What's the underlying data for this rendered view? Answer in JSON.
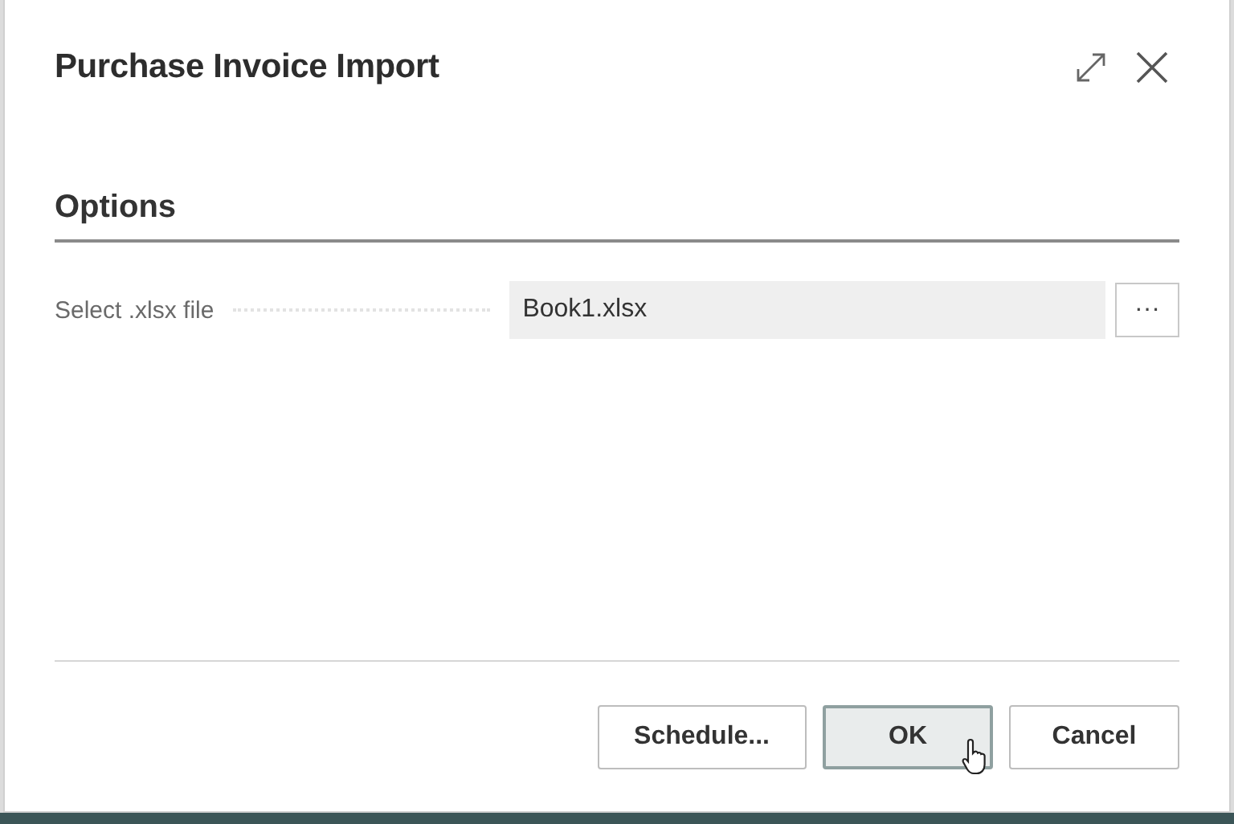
{
  "dialog": {
    "title": "Purchase Invoice Import"
  },
  "section": {
    "title": "Options"
  },
  "fields": [
    {
      "label": "Select .xlsx file",
      "value": "Book1.xlsx",
      "lookup": "···"
    }
  ],
  "buttons": [
    {
      "label": "Schedule...",
      "selected": false
    },
    {
      "label": "OK",
      "selected": true
    },
    {
      "label": "Cancel",
      "selected": false
    }
  ]
}
